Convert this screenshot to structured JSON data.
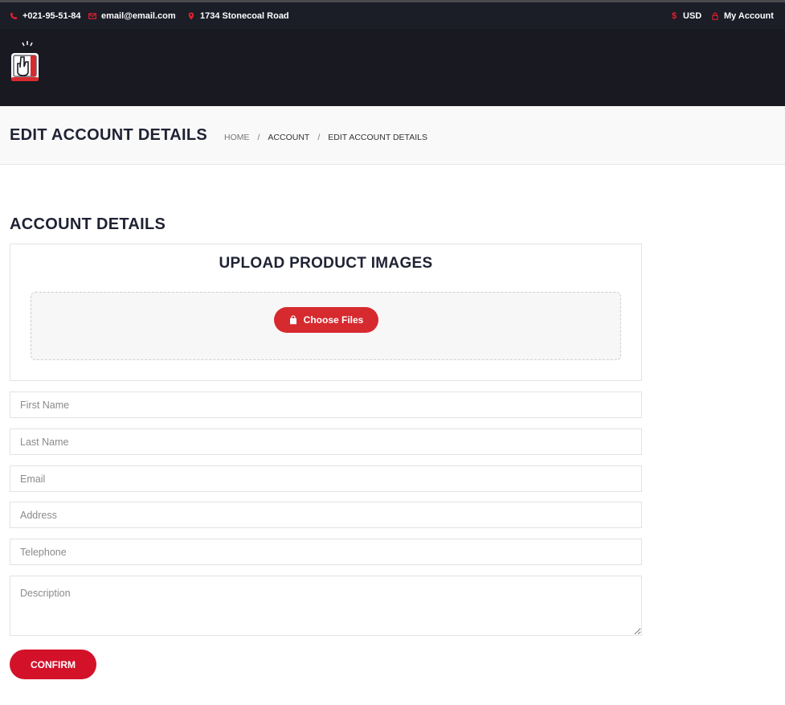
{
  "topbar": {
    "phone": "+021-95-51-84",
    "email": "email@email.com",
    "address": "1734 Stonecoal Road",
    "currency": "USD",
    "account": "My Account"
  },
  "page": {
    "title": "EDIT ACCOUNT DETAILS",
    "breadcrumb": [
      "HOME",
      "ACCOUNT",
      "EDIT ACCOUNT DETAILS"
    ]
  },
  "form": {
    "section_title": "ACCOUNT DETAILS",
    "upload_title": "UPLOAD PRODUCT IMAGES",
    "choose_files_label": "Choose Files",
    "fields": {
      "first_name": {
        "value": "",
        "placeholder": "First Name"
      },
      "last_name": {
        "value": "",
        "placeholder": "Last Name"
      },
      "email": {
        "value": "",
        "placeholder": "Email"
      },
      "address": {
        "value": "",
        "placeholder": "Address"
      },
      "telephone": {
        "value": "",
        "placeholder": "Telephone"
      },
      "description": {
        "value": "",
        "placeholder": "Description"
      }
    },
    "confirm_label": "CONFIRM"
  },
  "icons": {
    "phone": "phone-icon",
    "email": "envelope-icon",
    "address": "map-pin-icon",
    "currency": "dollar-icon",
    "account": "lock-icon",
    "upload": "shopping-bag-icon",
    "logo": "hand-pointer-logo"
  },
  "colors": {
    "accent": "#d3122a",
    "topbar_bg": "#1b1d27",
    "header_bg": "#181921",
    "text_dark": "#1f2233"
  }
}
